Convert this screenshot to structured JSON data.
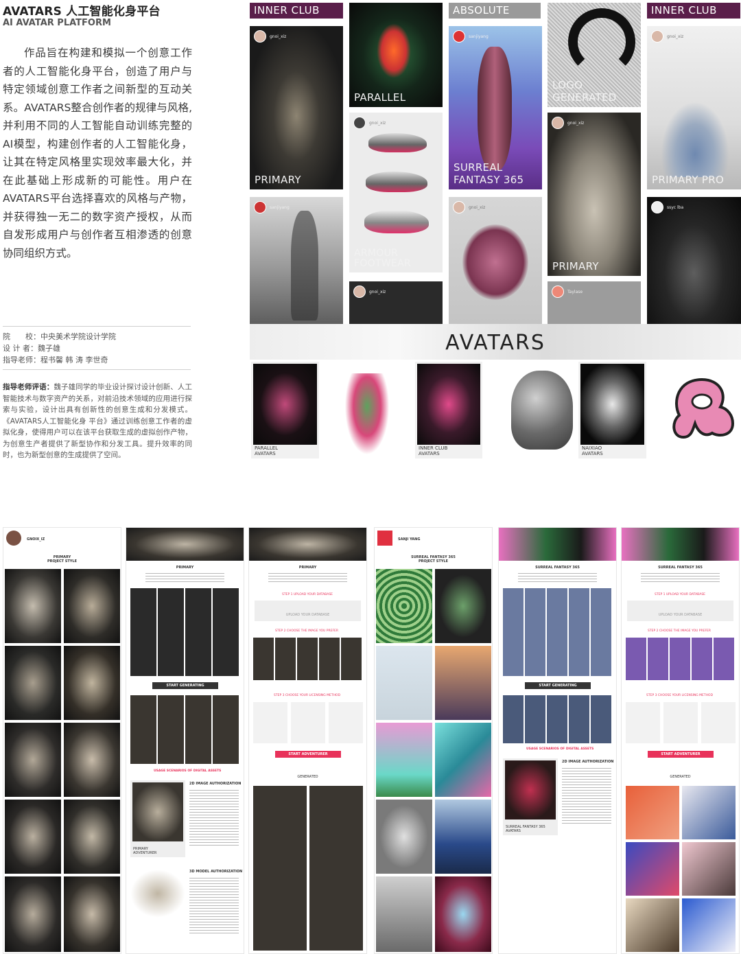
{
  "header": {
    "title": "AVATARS 人工智能化身平台",
    "subtitle": "AI AVATAR PLATFORM"
  },
  "description": "作品旨在构建和模拟一个创意工作者的人工智能化身平台，创造了用户与特定领域创意工作者之间新型的互动关系。AVATARS整合创作者的规律与风格,并利用不同的人工智能自动训练完整的AI模型，构建创作者的人工智能化身，让其在特定风格里实现效率最大化，并在此基础上形成新的可能性。用户在AVATARS平台选择喜欢的风格与产物，并获得独一无二的数字资产授权，从而自发形成用户与创作者互相渗透的创意协同组织方式。",
  "meta": {
    "school": "院　　校：中央美术学院设计学院",
    "designer": "设 计 者：魏子雄",
    "advisor": "指导老师：程书馨 韩 涛 李世奇"
  },
  "review": {
    "label": "指导老师评语：",
    "text": "魏子雄同学的毕业设计探讨设计创新、人工智能技术与数字资产的关系，对前沿技术领域的应用进行探索与实验，设计出具有创新性的创意生成和分发模式。《AVATARS人工智能化身 平台》通过训练创意工作者的虚拟化身，使得用户可以在该平台获取生成的虚拟创作产物，为创意生产者提供了新型协作和分发工具。提升效率的同时，也为新型创意的生成提供了空间。"
  },
  "gallery": {
    "bars": {
      "inner_club_1": "INNER CLUB",
      "absolute": "ABSOLUTE",
      "inner_club_2": "INNER CLUB"
    },
    "labels": {
      "primary_1": "PRIMARY",
      "parallel": "PARALLEL",
      "armour": "ARMOUR\nFOOTWEAR",
      "surreal": "SURREAL\nFANTASY 365",
      "logo": "LOGO\nGENERATED",
      "primary_2": "PRIMARY",
      "primary_pro": "PRIMARY PRO"
    },
    "users": {
      "u1": "gnoi_xiz",
      "u2": "sanjiyang",
      "u3": "gnoi_xiz",
      "u4": "gnoi_xiz",
      "u5": "gnoi_xiz",
      "u6": "sanjiyang",
      "u7": "ssyc lba",
      "u8": "gnoi_xiz",
      "u9": "Taylase"
    },
    "banner": "AVATARS",
    "polaroids": {
      "p1": "PARALLEL\nAVATARS",
      "p2": "INNER CLUB\nAVATARS",
      "p3": "NAIXIAO\nAVATARS"
    }
  },
  "mockups": {
    "m1": {
      "user": "GNOIX_IZ",
      "heading": "PRIMARY\nPROJECT STYLE"
    },
    "m2": {
      "heading": "PRIMARY",
      "button": "START GENERATING",
      "usage": "USAGE SCENARIOS OF DIGITAL ASSETS",
      "auth2d": "2D IMAGE AUTHORIZATION",
      "card": "PRIMARY\nADVENTURER",
      "auth3d": "3D MODEL AUTHORIZATION"
    },
    "m3": {
      "heading": "PRIMARY",
      "step1": "STEP 1 UPLOAD YOUR DATABASE",
      "upload": "UPLOAD YOUR DATABASE",
      "step2": "STEP 2 CHOOSE THE IMAGE YOU PREFER",
      "step3": "STEP 3 CHOOSE YOUR LICENSING METHOD",
      "button": "START ADVENTURER",
      "generated": "GENERATED"
    },
    "m4": {
      "user": "SANJI YANG",
      "heading": "SURREAL FANTASY 365\nPROJECT STYLE"
    },
    "m5": {
      "heading": "SURREAL FANTASY 365",
      "button": "START GENERATING",
      "usage": "USAGE SCENARIOS OF DIGITAL ASSETS",
      "auth2d": "2D IMAGE AUTHORIZATION",
      "card": "SURREAL FANTASY 365\nAVATARS"
    },
    "m6": {
      "heading": "SURREAL FANTASY 365",
      "step1": "STEP 1 UPLOAD YOUR DATABASE",
      "upload": "UPLOAD YOUR DATABASE",
      "step2": "STEP 2 CHOOSE THE IMAGE YOU PREFER",
      "step3": "STEP 3 CHOOSE YOUR LICENSING METHOD",
      "button": "START ADVENTURER",
      "generated": "GENERATED"
    }
  },
  "colors": {
    "inner_club_bar": "#5a1e4a",
    "absolute_bar": "#9a9a9a",
    "accent_pink": "#e8325a"
  }
}
